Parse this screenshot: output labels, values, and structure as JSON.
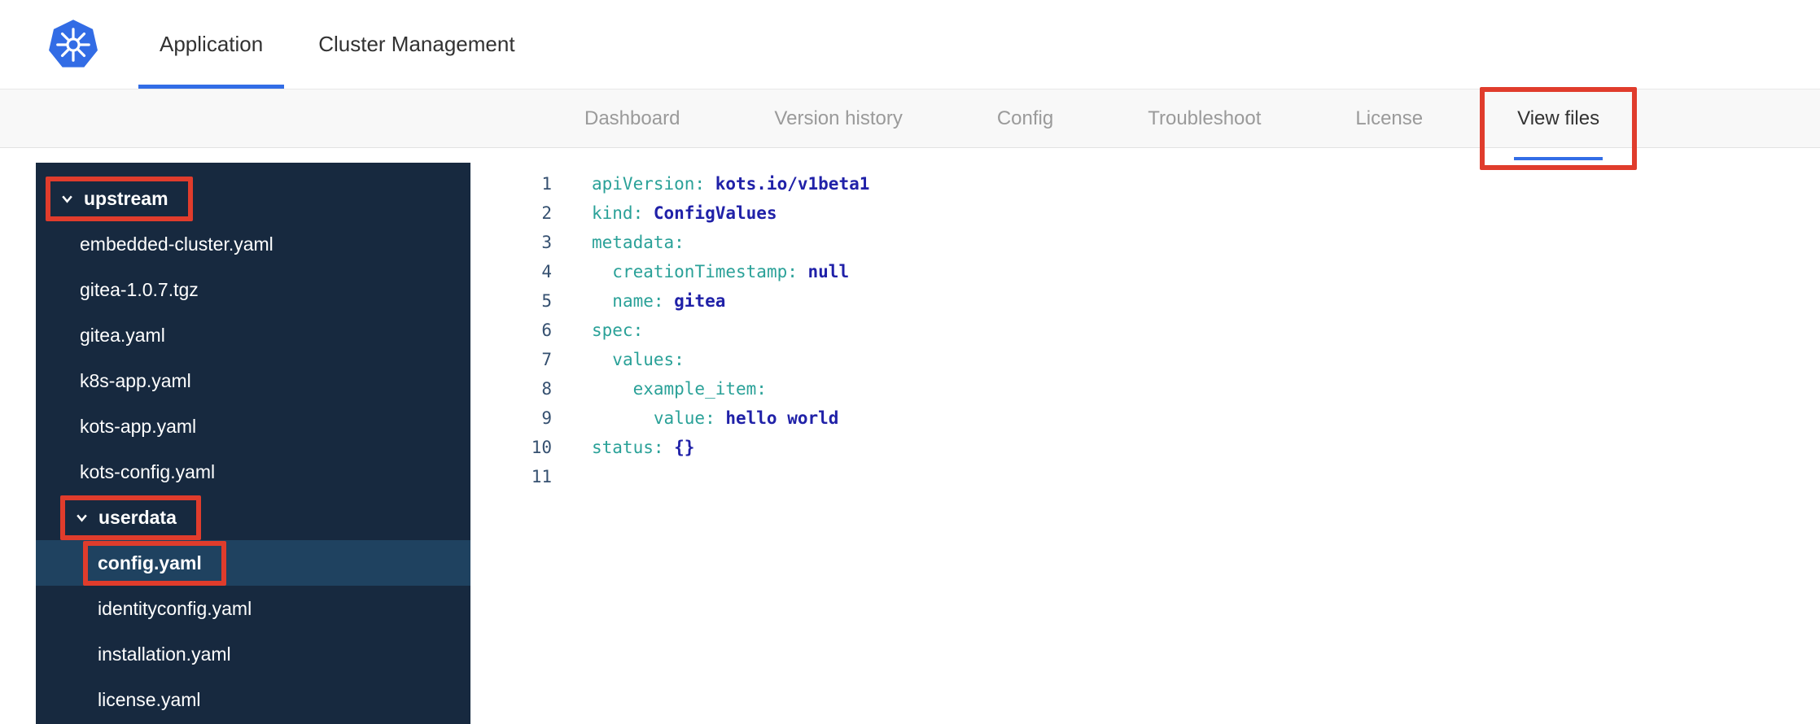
{
  "top_tabs": [
    {
      "label": "Application",
      "active": true
    },
    {
      "label": "Cluster Management",
      "active": false
    }
  ],
  "subnav_tabs": [
    {
      "label": "Dashboard",
      "active": false
    },
    {
      "label": "Version history",
      "active": false
    },
    {
      "label": "Config",
      "active": false
    },
    {
      "label": "Troubleshoot",
      "active": false
    },
    {
      "label": "License",
      "active": false
    },
    {
      "label": "View files",
      "active": true,
      "annotated": true
    }
  ],
  "file_tree": [
    {
      "label": "upstream",
      "type": "folder",
      "level": 0,
      "expanded": true,
      "annotated": true
    },
    {
      "label": "embedded-cluster.yaml",
      "type": "file",
      "level": 1
    },
    {
      "label": "gitea-1.0.7.tgz",
      "type": "file",
      "level": 1
    },
    {
      "label": "gitea.yaml",
      "type": "file",
      "level": 1
    },
    {
      "label": "k8s-app.yaml",
      "type": "file",
      "level": 1
    },
    {
      "label": "kots-app.yaml",
      "type": "file",
      "level": 1
    },
    {
      "label": "kots-config.yaml",
      "type": "file",
      "level": 1
    },
    {
      "label": "userdata",
      "type": "folder",
      "level": 1,
      "expanded": true,
      "annotated": true
    },
    {
      "label": "config.yaml",
      "type": "file",
      "level": 2,
      "selected": true,
      "annotated": true
    },
    {
      "label": "identityconfig.yaml",
      "type": "file",
      "level": 2
    },
    {
      "label": "installation.yaml",
      "type": "file",
      "level": 2
    },
    {
      "label": "license.yaml",
      "type": "file",
      "level": 2
    }
  ],
  "editor": {
    "lines": [
      {
        "num": "1",
        "tokens": [
          [
            "key",
            "apiVersion:"
          ],
          [
            "val",
            " kots.io/v1beta1"
          ]
        ]
      },
      {
        "num": "2",
        "tokens": [
          [
            "key",
            "kind:"
          ],
          [
            "val",
            " ConfigValues"
          ]
        ]
      },
      {
        "num": "3",
        "tokens": [
          [
            "key",
            "metadata:"
          ]
        ]
      },
      {
        "num": "4",
        "tokens": [
          [
            "plain",
            "  "
          ],
          [
            "key",
            "creationTimestamp:"
          ],
          [
            "val",
            " null"
          ]
        ]
      },
      {
        "num": "5",
        "tokens": [
          [
            "plain",
            "  "
          ],
          [
            "key",
            "name:"
          ],
          [
            "val",
            " gitea"
          ]
        ]
      },
      {
        "num": "6",
        "tokens": [
          [
            "key",
            "spec:"
          ]
        ]
      },
      {
        "num": "7",
        "tokens": [
          [
            "plain",
            "  "
          ],
          [
            "key",
            "values:"
          ]
        ]
      },
      {
        "num": "8",
        "tokens": [
          [
            "plain",
            "    "
          ],
          [
            "key",
            "example_item:"
          ]
        ]
      },
      {
        "num": "9",
        "tokens": [
          [
            "plain",
            "      "
          ],
          [
            "key",
            "value:"
          ],
          [
            "val",
            " hello world"
          ]
        ]
      },
      {
        "num": "10",
        "tokens": [
          [
            "key",
            "status:"
          ],
          [
            "val",
            " {}"
          ]
        ]
      },
      {
        "num": "11",
        "tokens": []
      }
    ]
  },
  "colors": {
    "annotation_red": "#e03c2c",
    "accent_blue": "#326de6",
    "kubernetes_blue": "#326ce5",
    "sidebar_bg": "#17293f",
    "sidebar_selected": "#1f4260",
    "code_key": "#2aa198",
    "code_value": "#2021a8"
  }
}
